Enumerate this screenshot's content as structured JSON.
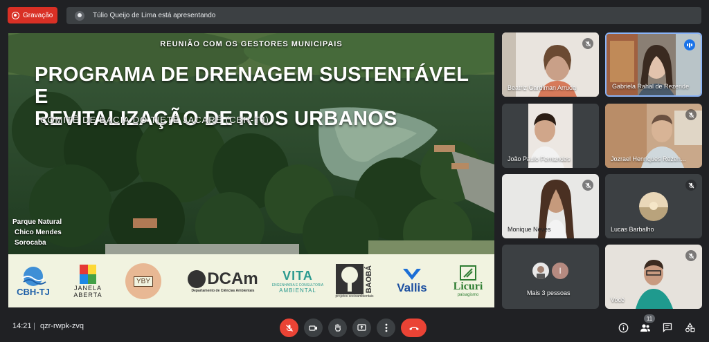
{
  "recording": {
    "label": "Gravação",
    "icon": "record-icon"
  },
  "presenting": {
    "text": "Túlio Queijo de Lima está apresentando",
    "icon": "presenter-avatar-icon"
  },
  "slide": {
    "subtitle_top": "REUNIÃO COM OS GESTORES MUNICIPAIS",
    "title_line1": "PROGRAMA DE DRENAGEM SUSTENTÁVEL E",
    "title_line2": "REVITALIZAÇÃO DE RIOS URBANOS",
    "committee": "COMITÊ DE BACIA DO TIETÊ JACARÉ (CBH-TJ)",
    "place_line1": "Parque Natural",
    "place_line2": "Chico Mendes",
    "place_line3": "Sorocaba",
    "logos": {
      "cbh": "CBH-TJ",
      "janela_line1": "JANELA",
      "janela_line2": "ABERTA",
      "yby": "YBY",
      "dcam": "DCAm",
      "dcam_sub": "Departamento de Ciências Ambientais",
      "vita": "VITA",
      "vita_sub1": "ENGENHARIA E CONSULTORIA",
      "vita_sub2": "AMBIENTAL",
      "baoba": "BAOBÁ",
      "baoba_sub": "projetos socioambientais",
      "vallis": "Vallis",
      "licuri": "Licuri",
      "licuri_sub": "paisagismo"
    }
  },
  "participants": [
    {
      "name": "Beatriz Gardiman Arruda",
      "status": "muted"
    },
    {
      "name": "Gabriela Rahal de Rezende",
      "status": "speaking"
    },
    {
      "name": "João Paulo Fernandes",
      "status": "none"
    },
    {
      "name": "Jozrael Henriques Rezen...",
      "status": "muted"
    },
    {
      "name": "Monique Neves",
      "status": "muted"
    },
    {
      "name": "Lucas Barbalho",
      "status": "muted"
    },
    {
      "name": "Mais 3 pessoas",
      "status": "none",
      "initial": "I"
    },
    {
      "name": "Você",
      "status": "muted"
    }
  ],
  "bottom": {
    "time": "14:21",
    "separator": "|",
    "code": "qzr-rwpk-zvq",
    "participants_count": "11"
  },
  "colors": {
    "hangup": "#ea4335",
    "mic_off": "#ea4335",
    "recording": "#d93025",
    "speaking": "#1a73e8"
  }
}
